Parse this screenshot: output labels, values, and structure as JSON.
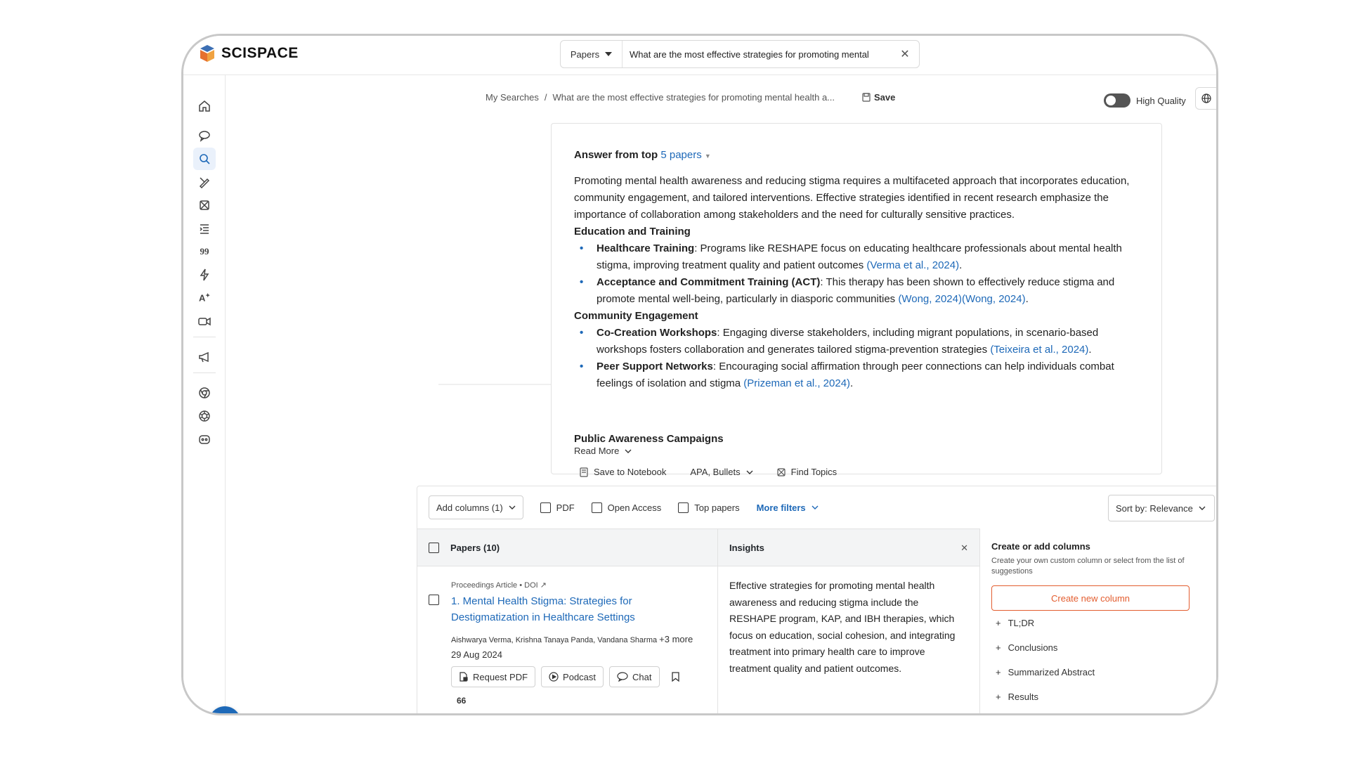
{
  "brand": {
    "name": "SCISPACE"
  },
  "search": {
    "type": "Papers",
    "query": "What are the most effective strategies for promoting mental"
  },
  "sidebar": {
    "items": [
      "home-icon",
      "chat-icon",
      "search-icon",
      "pen-icon",
      "grid-icon",
      "list-icon",
      "quote-icon",
      "lightning-icon",
      "text-ai-icon",
      "video-icon",
      "megaphone-icon",
      "chrome-icon",
      "openai-icon",
      "discord-icon"
    ],
    "active": "search-icon"
  },
  "breadcrumb": {
    "root": "My Searches",
    "separator": "/",
    "current": "What are the most effective strategies for promoting mental health a..."
  },
  "save_label": "Save",
  "high_quality_label": "High Quality",
  "answer": {
    "head_prefix": "Answer from top",
    "head_link": "5 papers",
    "intro": "Promoting mental health awareness and reducing stigma requires a multifaceted approach that incorporates education, community engagement, and tailored interventions. Effective strategies identified in recent research emphasize the importance of collaboration among stakeholders and the need for culturally sensitive practices.",
    "sections": [
      {
        "heading": "Education and Training",
        "bullets": [
          {
            "term": "Healthcare Training",
            "text": ": Programs like RESHAPE focus on educating healthcare professionals about mental health stigma, improving treatment quality and patient outcomes",
            "cite": "(Verma et al., 2024)"
          },
          {
            "term": "Acceptance and Commitment Training (ACT)",
            "text": ": This therapy has been shown to effectively reduce stigma and promote mental well-being, particularly in diasporic communities",
            "cite": "(Wong, 2024)(Wong, 2024)"
          }
        ]
      },
      {
        "heading": "Community Engagement",
        "bullets": [
          {
            "term": "Co-Creation Workshops",
            "text": ": Engaging diverse stakeholders, including migrant populations, in scenario-based workshops fosters collaboration and generates tailored stigma-prevention strategies",
            "cite": "(Teixeira et al., 2024)"
          },
          {
            "term": "Peer Support Networks",
            "text": ": Encouraging social affirmation through peer connections can help individuals combat feelings of isolation and stigma",
            "cite": "(Prizeman et al., 2024)"
          }
        ]
      }
    ],
    "peek_heading": "Public Awareness Campaigns",
    "read_more": "Read More",
    "actions": {
      "save_notebook": "Save to Notebook",
      "citation_style": "APA, Bullets",
      "find_topics": "Find Topics"
    }
  },
  "filters": {
    "add_columns": "Add columns (1)",
    "pdf": "PDF",
    "open_access": "Open Access",
    "top_papers": "Top papers",
    "more_filters": "More filters",
    "sort": "Sort by: Relevance"
  },
  "table": {
    "papers_header": "Papers (10)",
    "insights_header": "Insights",
    "rows": [
      {
        "meta": "Proceedings Article • DOI",
        "title": "1. Mental Health Stigma: Strategies for Destigmatization in Healthcare Settings",
        "authors": "Aishwarya Verma, Krishna Tanaya Panda, Vandana Sharma",
        "more_authors": "+3 more",
        "date": "29 Aug 2024",
        "request_pdf": "Request PDF",
        "podcast": "Podcast",
        "chat": "Chat",
        "count": "66",
        "insight": "Effective strategies for promoting mental health awareness and reducing stigma include the RESHAPE program, KAP, and IBH therapies, which focus on education, social cohesion, and integrating treatment into primary health care to improve treatment quality and patient outcomes."
      }
    ]
  },
  "add_columns_panel": {
    "title": "Create or add columns",
    "desc": "Create your own custom column or select from the list of suggestions",
    "create_btn": "Create new column",
    "suggestions": [
      "TL;DR",
      "Conclusions",
      "Summarized Abstract",
      "Results"
    ]
  },
  "colors": {
    "accent": "#1e69b8",
    "orange": "#e35d2f",
    "header_bg": "#f3f4f5"
  }
}
